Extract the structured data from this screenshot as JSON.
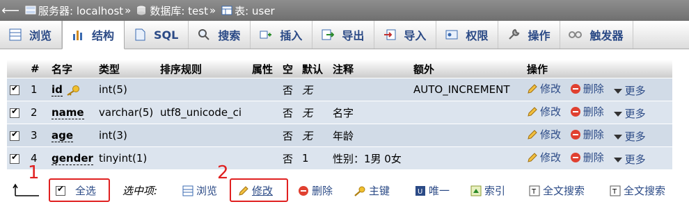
{
  "breadcrumb": {
    "server_label": "服务器: localhost",
    "db_label": "数据库: test",
    "table_label": "表: user",
    "sep": "»"
  },
  "tabs": [
    {
      "label": "浏览",
      "icon": "browse-icon"
    },
    {
      "label": "结构",
      "icon": "structure-icon",
      "active": true
    },
    {
      "label": "SQL",
      "icon": "sql-icon"
    },
    {
      "label": "搜索",
      "icon": "search-icon"
    },
    {
      "label": "插入",
      "icon": "insert-icon"
    },
    {
      "label": "导出",
      "icon": "export-icon"
    },
    {
      "label": "导入",
      "icon": "import-icon"
    },
    {
      "label": "权限",
      "icon": "privileges-icon"
    },
    {
      "label": "操作",
      "icon": "wrench-icon"
    },
    {
      "label": "触发器",
      "icon": "triggers-icon"
    }
  ],
  "table": {
    "headers": [
      "#",
      "名字",
      "类型",
      "排序规则",
      "属性",
      "空",
      "默认",
      "注释",
      "额外",
      "操作"
    ],
    "rows": [
      {
        "num": "1",
        "name": "id",
        "type": "int(5)",
        "collation": "",
        "attr": "",
        "null": "否",
        "default": "无",
        "comment": "",
        "extra": "AUTO_INCREMENT",
        "primary_key": true
      },
      {
        "num": "2",
        "name": "name",
        "type": "varchar(5)",
        "collation": "utf8_unicode_ci",
        "attr": "",
        "null": "否",
        "default": "无",
        "comment": "名字",
        "extra": ""
      },
      {
        "num": "3",
        "name": "age",
        "type": "int(3)",
        "collation": "",
        "attr": "",
        "null": "否",
        "default": "无",
        "comment": "年龄",
        "extra": ""
      },
      {
        "num": "4",
        "name": "gender",
        "type": "tinyint(1)",
        "collation": "",
        "attr": "",
        "null": "否",
        "default": "1",
        "comment": "性别：1男 0女",
        "extra": ""
      }
    ],
    "actions": {
      "edit": "修改",
      "drop": "删除",
      "more": "更多"
    }
  },
  "bottom": {
    "select_all": "全选",
    "with_selected": "选中项:",
    "browse": "浏览",
    "change": "修改",
    "drop": "删除",
    "primary": "主键",
    "unique": "唯一",
    "index": "索引",
    "fulltext": "全文搜索",
    "fulltext2": "全文搜索"
  },
  "annotations": {
    "num1": "1",
    "num2": "2"
  }
}
